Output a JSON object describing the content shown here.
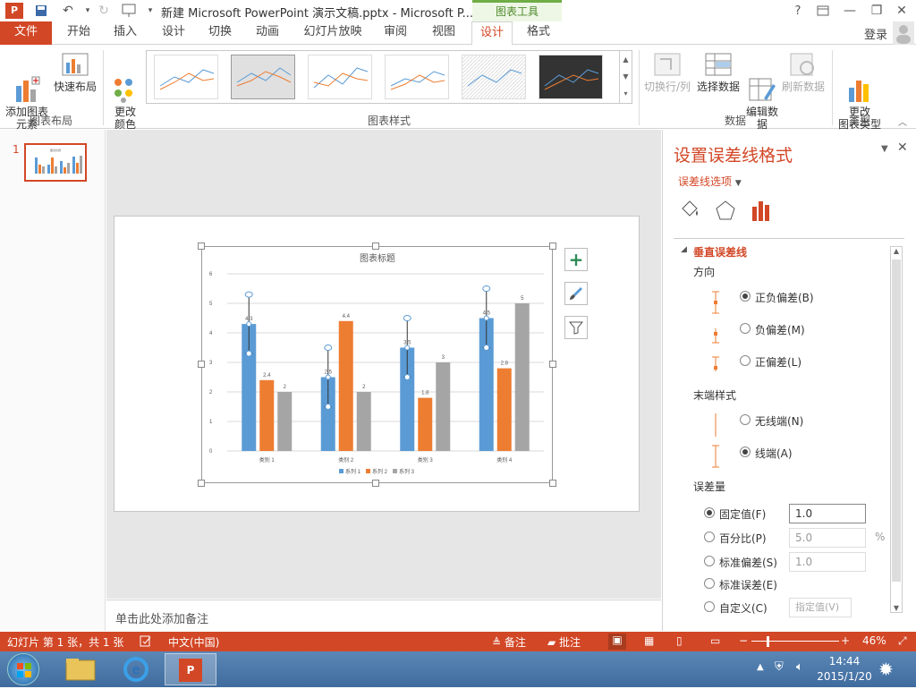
{
  "titlebar": {
    "title": "新建 Microsoft PowerPoint 演示文稿.pptx - Microsoft P...",
    "context_tab": "图表工具",
    "help": "?",
    "login": "登录"
  },
  "tabs": [
    "文件",
    "开始",
    "插入",
    "设计",
    "切换",
    "动画",
    "幻灯片放映",
    "审阅",
    "视图",
    "设计",
    "格式"
  ],
  "ribbon": {
    "add_element": "添加图表\n元素",
    "quick_layout": "快速布局",
    "group_layout": "图表布局",
    "change_color": "更改\n颜色",
    "group_styles": "图表样式",
    "switch_rowcol": "切换行/列",
    "select_data": "选择数据",
    "edit_data": "编辑数\n据",
    "refresh_data": "刷新数据",
    "group_data": "数据",
    "change_type": "更改\n图表类型",
    "group_type": "类型"
  },
  "slides": {
    "number": "1"
  },
  "notes_placeholder": "单击此处添加备注",
  "chart_data": {
    "type": "bar",
    "title": "图表标题",
    "categories": [
      "类别 1",
      "类别 2",
      "类别 3",
      "类别 4"
    ],
    "series": [
      {
        "name": "系列 1",
        "values": [
          4.3,
          2.5,
          3.5,
          4.5
        ],
        "color": "#5b9bd5",
        "error_bar": 1.0
      },
      {
        "name": "系列 2",
        "values": [
          2.4,
          4.4,
          1.8,
          2.8
        ],
        "color": "#ed7d31"
      },
      {
        "name": "系列 3",
        "values": [
          2,
          2,
          3,
          5
        ],
        "color": "#a5a5a5"
      }
    ],
    "ylim": [
      0,
      6
    ],
    "yticks": [
      "0",
      "1",
      "2",
      "3",
      "4",
      "5",
      "6"
    ],
    "grid": true,
    "legend": "bottom"
  },
  "panel": {
    "title": "设置误差线格式",
    "options_label": "误差线选项",
    "section": "垂直误差线",
    "direction_label": "方向",
    "dir_both": "正负偏差(B)",
    "dir_minus": "负偏差(M)",
    "dir_plus": "正偏差(L)",
    "end_style_label": "末端样式",
    "end_none": "无线端(N)",
    "end_cap": "线端(A)",
    "amount_label": "误差量",
    "fixed": "固定值(F)",
    "fixed_value": "1.0",
    "percent": "百分比(P)",
    "percent_value": "5.0",
    "percent_unit": "%",
    "stddev": "标准偏差(S)",
    "stddev_value": "1.0",
    "stderr": "标准误差(E)",
    "custom": "自定义(C)",
    "specify": "指定值(V)"
  },
  "status": {
    "slide_info": "幻灯片 第 1 张，共 1 张",
    "language": "中文(中国)",
    "notes": "备注",
    "comments": "批注",
    "zoom": "46%"
  },
  "taskbar": {
    "time": "14:44",
    "date": "2015/1/20"
  },
  "colors": {
    "accent": "#d24726",
    "series1": "#5b9bd5",
    "series2": "#ed7d31",
    "series3": "#a5a5a5"
  }
}
